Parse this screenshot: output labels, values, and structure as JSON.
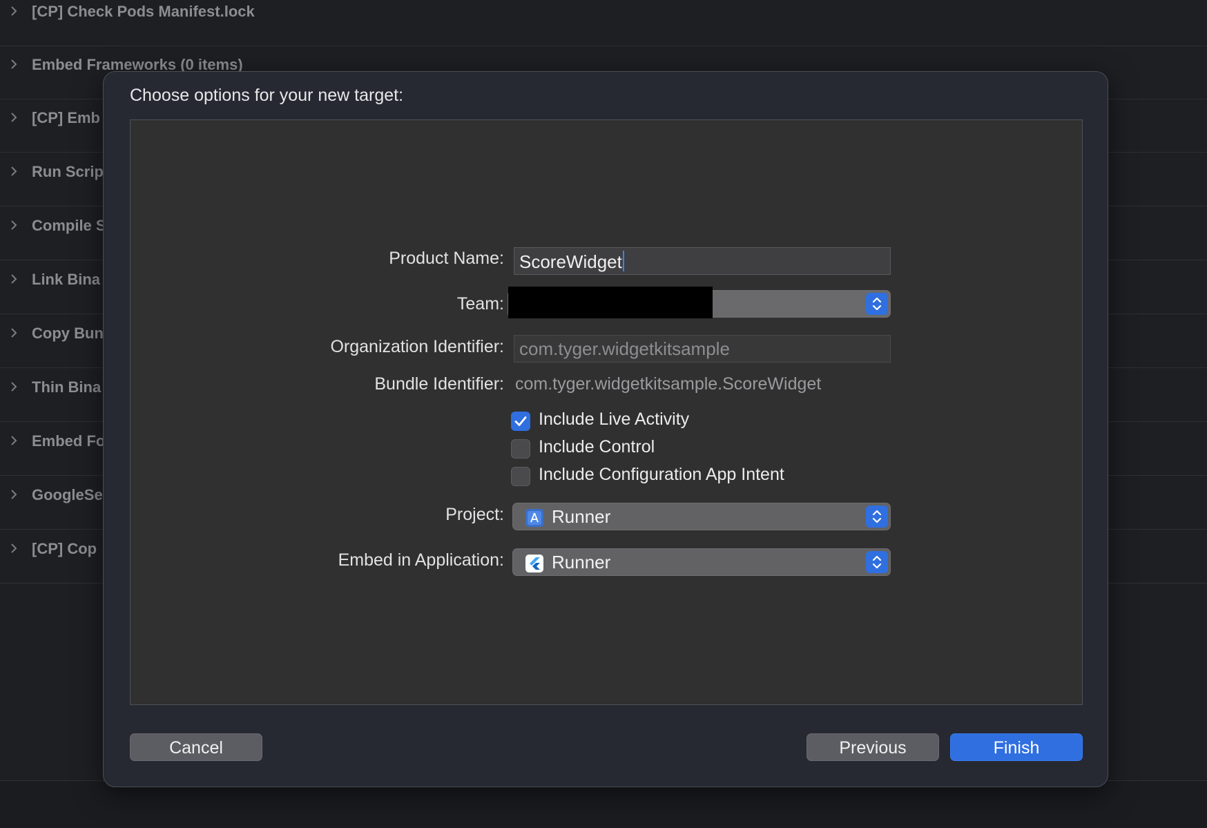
{
  "background": {
    "phases": [
      "[CP] Check Pods Manifest.lock",
      "Embed Frameworks (0 items)",
      "[CP] Emb",
      "Run Scrip",
      "Compile S",
      "Link Bina",
      "Copy Bun",
      "Thin Bina",
      "Embed Fo",
      "GoogleSe",
      "[CP] Cop"
    ]
  },
  "dialog": {
    "title": "Choose options for your new target:",
    "form": {
      "product_name": {
        "label": "Product Name:",
        "value": "ScoreWidget"
      },
      "team": {
        "label": "Team:",
        "value": ""
      },
      "organization_identifier": {
        "label": "Organization Identifier:",
        "placeholder": "com.tyger.widgetkitsample"
      },
      "bundle_identifier": {
        "label": "Bundle Identifier:",
        "value": "com.tyger.widgetkitsample.ScoreWidget"
      },
      "checkboxes": [
        {
          "label": "Include Live Activity",
          "checked": true
        },
        {
          "label": "Include Control",
          "checked": false
        },
        {
          "label": "Include Configuration App Intent",
          "checked": false
        }
      ],
      "project": {
        "label": "Project:",
        "value": "Runner",
        "icon": "xcode-project-icon"
      },
      "embed_in_application": {
        "label": "Embed in Application:",
        "value": "Runner",
        "icon": "flutter-app-icon"
      }
    },
    "buttons": {
      "cancel": "Cancel",
      "previous": "Previous",
      "finish": "Finish"
    }
  },
  "colors": {
    "accent": "#2f6fe0",
    "dialog_bg": "#262932",
    "panel_bg": "#303030"
  }
}
